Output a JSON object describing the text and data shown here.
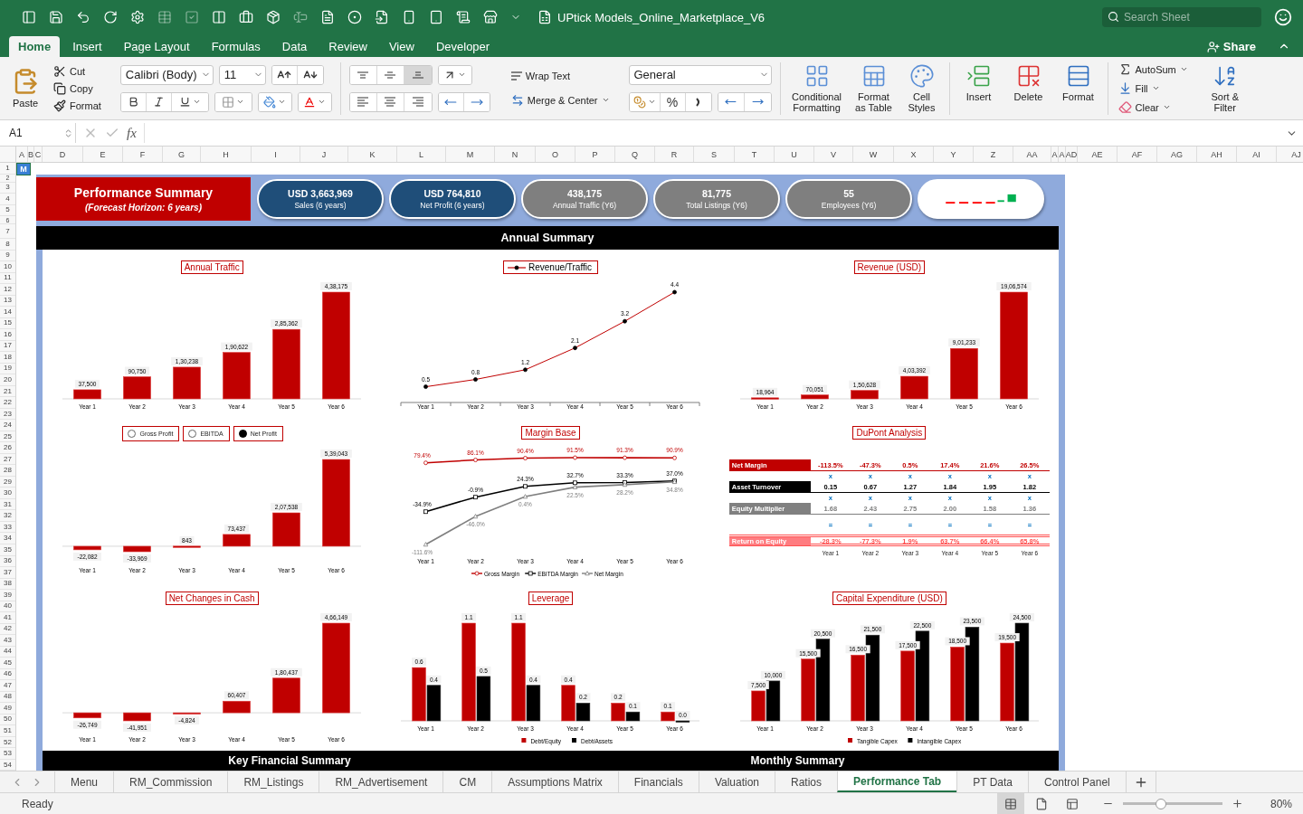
{
  "window": {
    "title": "UPtick Models_Online_Marketplace_V6",
    "search_placeholder": "Search Sheet"
  },
  "ribbon_tabs": [
    {
      "label": "Home",
      "selected": true
    },
    {
      "label": "Insert",
      "selected": false
    },
    {
      "label": "Page Layout",
      "selected": false
    },
    {
      "label": "Formulas",
      "selected": false
    },
    {
      "label": "Data",
      "selected": false
    },
    {
      "label": "Review",
      "selected": false
    },
    {
      "label": "View",
      "selected": false
    },
    {
      "label": "Developer",
      "selected": false
    }
  ],
  "share": "Share",
  "ribbon": {
    "paste": "Paste",
    "clipboard": [
      "Cut",
      "Copy",
      "Format"
    ],
    "font_name": "Calibri (Body)",
    "font_size": "11",
    "vertical_align": [
      {
        "kind": "top",
        "selected": false
      },
      {
        "kind": "middle",
        "selected": false
      },
      {
        "kind": "bottom",
        "selected": true
      }
    ],
    "wrap_text": "Wrap Text",
    "merge": "Merge & Center",
    "number_format": "General",
    "percent": "%",
    "styles": [
      "Conditional Formatting",
      "Format as Table",
      "Cell Styles"
    ],
    "cells": [
      "Insert",
      "Delete",
      "Format"
    ],
    "editing": [
      "AutoSum",
      "Fill",
      "Clear"
    ],
    "sort_filter": "Sort & Filter"
  },
  "formula_bar": {
    "name_box": "A1",
    "fx": "fx"
  },
  "columns": [
    "A",
    "B",
    "C",
    "D",
    "E",
    "F",
    "G",
    "H",
    "I",
    "J",
    "K",
    "L",
    "M",
    "N",
    "O",
    "P",
    "Q",
    "R",
    "S",
    "T",
    "U",
    "V",
    "W",
    "X",
    "Y",
    "Z",
    "AA",
    "A",
    "A",
    "AD",
    "AE",
    "AF",
    "AG",
    "AH",
    "AI",
    "AJ"
  ],
  "rows": [
    "1",
    "2",
    "3",
    "4",
    "5",
    "6",
    "7",
    "8",
    "9",
    "10",
    "11",
    "12",
    "13",
    "14",
    "15",
    "16",
    "17",
    "18",
    "19",
    "20",
    "21",
    "22",
    "23",
    "24",
    "25",
    "26",
    "27",
    "28",
    "29",
    "30",
    "31",
    "32",
    "33",
    "34",
    "35",
    "36",
    "37",
    "38",
    "39",
    "40",
    "41",
    "42",
    "43",
    "44",
    "45",
    "46",
    "47",
    "48",
    "49",
    "50",
    "51",
    "52",
    "53",
    "54"
  ],
  "cell_mark": "M",
  "dashboard": {
    "header": {
      "title": "Performance Summary",
      "subtitle": "(Forecast Horizon: 6 years)"
    },
    "kpis": [
      {
        "kind": "primary",
        "value": "USD 3,663,969",
        "label": "Sales (6 years)"
      },
      {
        "kind": "primary",
        "value": "USD 764,810",
        "label": "Net Profit (6 years)"
      },
      {
        "kind": "secondary",
        "value": "438,175",
        "label": "Annual Traffic (Y6)"
      },
      {
        "kind": "secondary",
        "value": "81,775",
        "label": "Total Listings (Y6)"
      },
      {
        "kind": "secondary",
        "value": "55",
        "label": "Employees (Y6)"
      },
      {
        "kind": "sparkline"
      }
    ],
    "section_title": "Annual Summary",
    "panels": [
      {
        "kind": "chart",
        "chart_data": {
          "type": "bar",
          "title": "Annual Traffic",
          "categories": [
            "Year 1",
            "Year 2",
            "Year 3",
            "Year 4",
            "Year 5",
            "Year 6"
          ],
          "series": [
            {
              "color": "#c00000",
              "values": [
                37500,
                90750,
                130238,
                190622,
                285362,
                438175
              ],
              "value_labels": [
                "37,500",
                "90,750",
                "1,30,238",
                "1,90,622",
                "2,85,362",
                "4,38,175"
              ]
            }
          ]
        }
      },
      {
        "kind": "chart",
        "x_axis_line": true,
        "chart_data": {
          "type": "line",
          "legend": "top",
          "categories": [
            "Year 1",
            "Year 2",
            "Year 3",
            "Year 4",
            "Year 5",
            "Year 6"
          ],
          "series": [
            {
              "name": "Revenue/Traffic",
              "color": "#c00000",
              "marker": "circle",
              "values": [
                0.5,
                0.8,
                1.2,
                2.1,
                3.2,
                4.4
              ],
              "value_labels": [
                "0.5",
                "0.8",
                "1.2",
                "2.1",
                "3.2",
                "4.4"
              ]
            }
          ]
        }
      },
      {
        "kind": "chart",
        "chart_data": {
          "type": "bar",
          "title": "Revenue (USD)",
          "categories": [
            "Year 1",
            "Year 2",
            "Year 3",
            "Year 4",
            "Year 5",
            "Year 6"
          ],
          "series": [
            {
              "color": "#c00000",
              "values": [
                18964,
                70051,
                150628,
                403392,
                901233,
                1906574
              ],
              "value_labels": [
                "18,964",
                "70,051",
                "1,50,628",
                "4,03,392",
                "9,01,233",
                "19,06,574"
              ]
            }
          ]
        }
      },
      {
        "kind": "chart",
        "selector": [
          {
            "label": "Gross Profit",
            "selected": false
          },
          {
            "label": "EBITDA",
            "selected": false
          },
          {
            "label": "Net Profit",
            "selected": true
          }
        ],
        "chart_data": {
          "type": "bar",
          "categories": [
            "Year 1",
            "Year 2",
            "Year 3",
            "Year 4",
            "Year 5",
            "Year 6"
          ],
          "series": [
            {
              "color": "#c00000",
              "values": [
                -22082,
                -33969,
                843,
                73437,
                207538,
                539043
              ],
              "value_labels": [
                "-22,082",
                "-33,969",
                "843",
                "73,437",
                "2,07,538",
                "5,39,043"
              ]
            }
          ]
        }
      },
      {
        "kind": "chart",
        "chart_data": {
          "type": "line",
          "title": "Margin Base",
          "legend": "bottom",
          "categories": [
            "Year 1",
            "Year 2",
            "Year 3",
            "Year 4",
            "Year 5",
            "Year 6"
          ],
          "series": [
            {
              "name": "Gross Margin",
              "color": "#c00000",
              "marker": "circle",
              "values": [
                79.4,
                86.1,
                90.4,
                91.5,
                91.3,
                90.9
              ],
              "value_labels": [
                "79.4%",
                "86.1%",
                "90.4%",
                "91.5%",
                "91.3%",
                "90.9%"
              ]
            },
            {
              "name": "EBITDA Margin",
              "color": "#000000",
              "marker": "square",
              "values": [
                -34.9,
                -0.9,
                24.3,
                32.7,
                33.3,
                37.0
              ],
              "value_labels": [
                "-34.9%",
                "-0.9%",
                "24.3%",
                "32.7%",
                "33.3%",
                "37.0%"
              ]
            },
            {
              "name": "Net Margin",
              "color": "#7f7f7f",
              "marker": "triangle",
              "values": [
                -111.6,
                -46.0,
                0.4,
                22.5,
                28.2,
                34.8
              ],
              "value_labels": [
                "-111.6%",
                "-46.0%",
                "0.4%",
                "22.5%",
                "28.2%",
                "34.8%"
              ]
            }
          ]
        }
      },
      {
        "kind": "table",
        "title": "DuPont Analysis",
        "rows": [
          {
            "kind": "margin",
            "label": "Net Margin",
            "cells": [
              "-113.5%",
              "-47.3%",
              "0.5%",
              "17.4%",
              "21.6%",
              "26.5%"
            ]
          },
          {
            "kind": "operator",
            "cells": [
              "x",
              "x",
              "x",
              "x",
              "x",
              "x"
            ]
          },
          {
            "kind": "turnover",
            "label": "Asset Turnover",
            "cells": [
              "0.15",
              "0.67",
              "1.27",
              "1.84",
              "1.95",
              "1.82"
            ]
          },
          {
            "kind": "operator",
            "cells": [
              "x",
              "x",
              "x",
              "x",
              "x",
              "x"
            ]
          },
          {
            "kind": "multiplier",
            "label": "Equity Multiplier",
            "cells": [
              "1.68",
              "2.43",
              "2.75",
              "2.00",
              "1.58",
              "1.36"
            ]
          },
          {
            "kind": "operator",
            "cells": [
              "=",
              "=",
              "=",
              "=",
              "=",
              "="
            ]
          },
          {
            "kind": "result",
            "label": "Return on Equity",
            "cells": [
              "-28.3%",
              "-77.3%",
              "1.9%",
              "63.7%",
              "66.4%",
              "65.8%"
            ]
          },
          {
            "kind": "years",
            "cells": [
              "Year 1",
              "Year 2",
              "Year 3",
              "Year 4",
              "Year 5",
              "Year 6"
            ]
          }
        ]
      },
      {
        "kind": "chart",
        "chart_data": {
          "type": "bar",
          "title": "Net Changes in Cash",
          "categories": [
            "Year 1",
            "Year 2",
            "Year 3",
            "Year 4",
            "Year 5",
            "Year 6"
          ],
          "series": [
            {
              "color": "#c00000",
              "values": [
                -26749,
                -41951,
                -4824,
                60407,
                180437,
                466149
              ],
              "value_labels": [
                "-26,749",
                "-41,951",
                "-4,824",
                "60,407",
                "1,80,437",
                "4,66,149"
              ]
            }
          ]
        }
      },
      {
        "kind": "chart",
        "chart_data": {
          "type": "bar",
          "title": "Leverage",
          "legend": "bottom",
          "categories": [
            "Year 1",
            "Year 2",
            "Year 3",
            "Year 4",
            "Year 5",
            "Year 6"
          ],
          "series": [
            {
              "name": "Debt/Equity",
              "color": "#c00000",
              "values": [
                0.6,
                1.1,
                1.1,
                0.4,
                0.2,
                0.1
              ],
              "value_labels": [
                "0.6",
                "1.1",
                "1.1",
                "0.4",
                "0.2",
                "0.1"
              ]
            },
            {
              "name": "Debt/Assets",
              "color": "#000000",
              "values": [
                0.4,
                0.5,
                0.4,
                0.2,
                0.1,
                0.0
              ],
              "value_labels": [
                "0.4",
                "0.5",
                "0.4",
                "0.2",
                "0.1",
                "0.0"
              ]
            }
          ]
        }
      },
      {
        "kind": "chart",
        "chart_data": {
          "type": "bar",
          "title": "Capital Expenditure (USD)",
          "legend": "bottom",
          "categories": [
            "Year 1",
            "Year 2",
            "Year 3",
            "Year 4",
            "Year 5",
            "Year 6"
          ],
          "series": [
            {
              "name": "Tangible Capex",
              "color": "#c00000",
              "values": [
                7500,
                15500,
                16500,
                17500,
                18500,
                19500
              ],
              "value_labels": [
                "7,500",
                "15,500",
                "16,500",
                "17,500",
                "18,500",
                "19,500"
              ]
            },
            {
              "name": "Intangible Capex",
              "color": "#000000",
              "values": [
                10000,
                20500,
                21500,
                22500,
                23500,
                24500
              ],
              "value_labels": [
                "10,000",
                "20,500",
                "21,500",
                "22,500",
                "23,500",
                "24,500"
              ]
            }
          ]
        }
      }
    ],
    "footer_sections": [
      "Key Financial Summary",
      "Monthly Summary"
    ]
  },
  "sheet_tabs": [
    {
      "label": "Menu",
      "selected": false
    },
    {
      "label": "RM_Commission",
      "selected": false
    },
    {
      "label": "RM_Listings",
      "selected": false
    },
    {
      "label": "RM_Advertisement",
      "selected": false
    },
    {
      "label": "CM",
      "selected": false
    },
    {
      "label": "Assumptions Matrix",
      "selected": false
    },
    {
      "label": "Financials",
      "selected": false
    },
    {
      "label": "Valuation",
      "selected": false
    },
    {
      "label": "Ratios",
      "selected": false
    },
    {
      "label": "Performance Tab",
      "selected": true
    },
    {
      "label": "PT Data",
      "selected": false
    },
    {
      "label": "Control Panel",
      "selected": false
    }
  ],
  "status_bar": {
    "status": "Ready",
    "views": [
      {
        "kind": "normal",
        "selected": true
      },
      {
        "kind": "page_layout",
        "selected": false
      },
      {
        "kind": "page_break",
        "selected": false
      }
    ],
    "zoom": {
      "level": 0.38,
      "reading": "80%"
    }
  }
}
